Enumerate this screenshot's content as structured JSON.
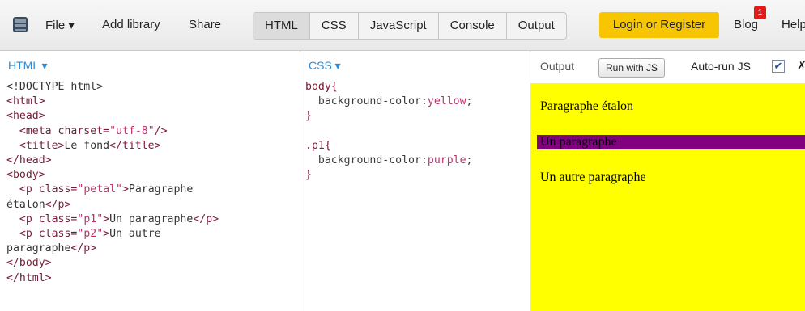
{
  "menu": {
    "file": "File ▾",
    "add_library": "Add library",
    "share": "Share"
  },
  "tabs": [
    "HTML",
    "CSS",
    "JavaScript",
    "Console",
    "Output"
  ],
  "login_label": "Login or Register",
  "blog_label": "Blog",
  "blog_badge": "1",
  "help_label": "Help",
  "html_pane": {
    "title": "HTML ▾"
  },
  "css_pane": {
    "title": "CSS ▾"
  },
  "output_pane": {
    "label": "Output",
    "run_label": "Run with JS",
    "autorun_label": "Auto-run JS",
    "checkbox_mark": "✔",
    "x_label": "✗",
    "paragraph_etalon": "Paragraphe étalon",
    "paragraph_1": "Un paragraphe",
    "paragraph_2": "Un autre paragraphe"
  },
  "colors": {
    "output_background": "#ffff00",
    "p1_background": "#800080",
    "accent_login": "#f7c600"
  }
}
